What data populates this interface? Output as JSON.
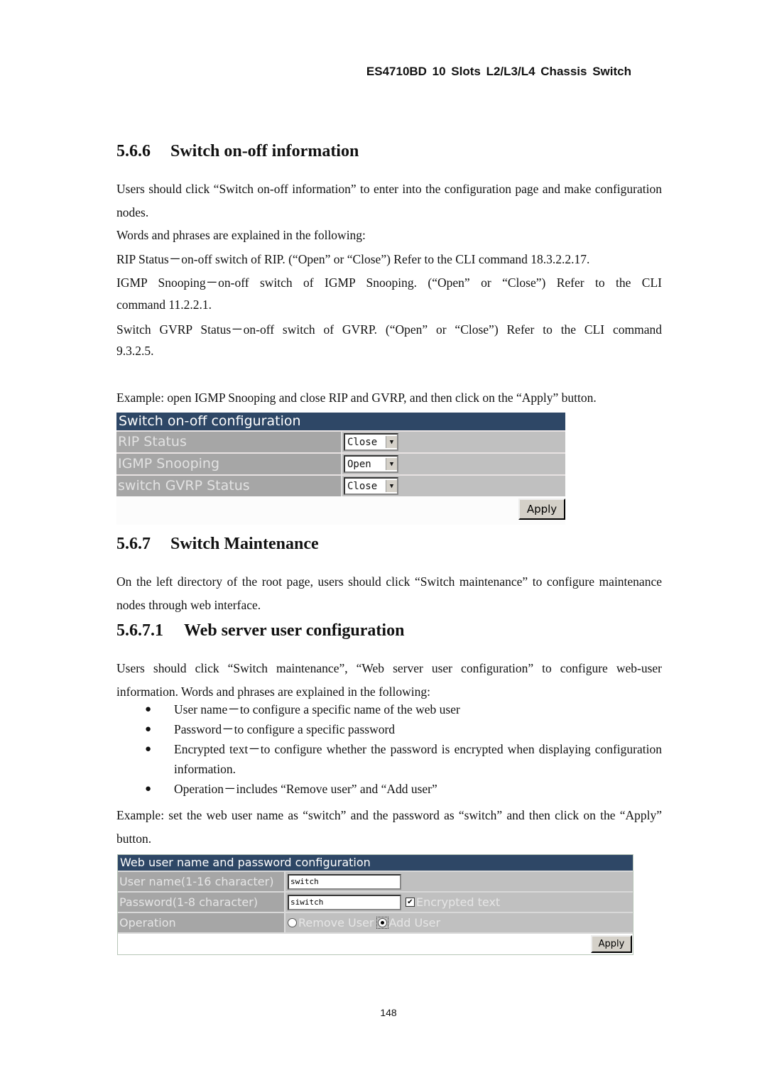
{
  "running_header": "ES4710BD 10 Slots L2/L3/L4 Chassis Switch",
  "section_566": {
    "number": "5.6.6",
    "title": "Switch on-off information",
    "intro": "Users should click “Switch on-off information” to enter into the configuration page and make configuration nodes.",
    "words_intro": "Words and phrases are explained in the following:",
    "rip_line": "RIP Status－on-off switch of RIP. (“Open” or “Close”) Refer to the CLI command 18.3.2.2.17.",
    "igmp_line1": "IGMP Snooping－on-off switch of IGMP Snooping. (“Open” or “Close”) Refer to the CLI",
    "igmp_line2": "command 11.2.2.1.",
    "gvrp_line1": "Switch GVRP Status－on-off switch of GVRP. (“Open” or “Close”) Refer to the CLI command",
    "gvrp_line2": "9.3.2.5.",
    "example": "Example: open IGMP Snooping and close RIP and GVRP, and then click on the “Apply” button."
  },
  "onoff_panel": {
    "title": "Switch on-off configuration",
    "rows": [
      {
        "label": "RIP Status",
        "value": "Close"
      },
      {
        "label": "IGMP Snooping",
        "value": "Open"
      },
      {
        "label": "switch GVRP Status",
        "value": "Close"
      }
    ],
    "apply_label": "Apply"
  },
  "section_567": {
    "number": "5.6.7",
    "title": "Switch Maintenance",
    "intro": "On the left directory of the root page, users should click “Switch maintenance” to configure maintenance nodes through web interface."
  },
  "section_5671": {
    "number": "5.6.7.1",
    "title": "Web server user configuration",
    "intro": "Users should click “Switch maintenance”, “Web server user configuration” to configure web-user information. Words and phrases are explained in the following:",
    "bullets": [
      "User name－to configure a specific name of the web user",
      "Password－to configure a specific password",
      "Encrypted text－to configure whether the password is encrypted when displaying configuration information.",
      "Operation－includes “Remove user” and “Add user”"
    ],
    "example": "Example: set the web user name as “switch” and the password as “switch” and then click on the “Apply” button."
  },
  "webuser_panel": {
    "title": "Web user name and password configuration",
    "username_label": "User name(1-16 character)",
    "username_value": "switch",
    "password_label": "Password(1-8 character)",
    "password_value": "siwitch",
    "encrypted_label": "Encrypted text",
    "encrypted_checked": true,
    "operation_label": "Operation",
    "remove_user_label": "Remove User",
    "add_user_label": "Add User",
    "selected_operation": "Add User",
    "apply_label": "Apply"
  },
  "page_number": "148"
}
